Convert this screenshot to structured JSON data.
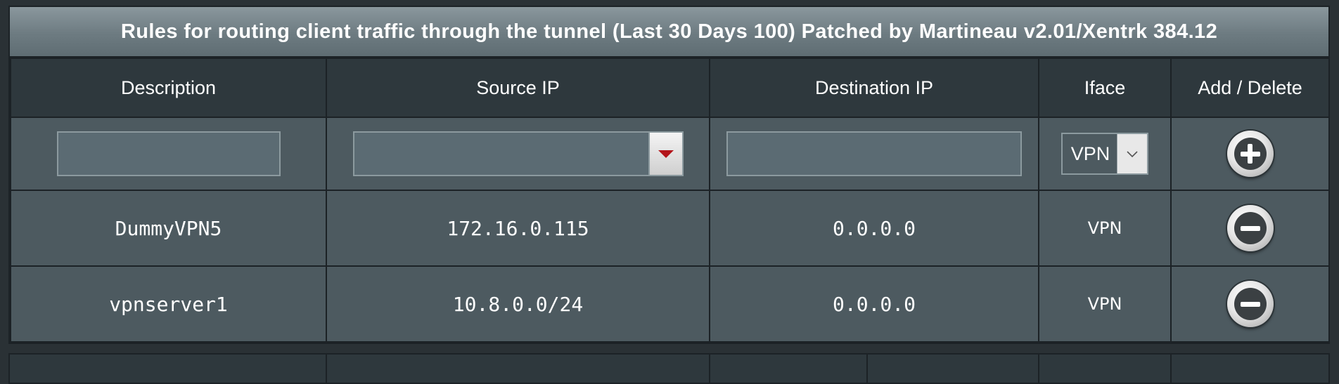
{
  "title": "Rules for routing client traffic through the tunnel (Last 30 Days 100) Patched by Martineau v2.01/Xentrk 384.12",
  "columns": {
    "description": "Description",
    "source_ip": "Source IP",
    "destination_ip": "Destination IP",
    "iface": "Iface",
    "add_delete": "Add / Delete"
  },
  "new_rule": {
    "description_value": "",
    "source_ip_value": "",
    "destination_ip_value": "",
    "iface_selected": "VPN",
    "add_icon": "plus-circle-icon",
    "source_dropdown_icon": "triangle-down-icon"
  },
  "rules": [
    {
      "description": "DummyVPN5",
      "source_ip": "172.16.0.115",
      "destination_ip": "0.0.0.0",
      "iface": "VPN",
      "delete_icon": "minus-circle-icon"
    },
    {
      "description": "vpnserver1",
      "source_ip": "10.8.0.0/24",
      "destination_ip": "0.0.0.0",
      "iface": "VPN",
      "delete_icon": "minus-circle-icon"
    }
  ],
  "colors": {
    "header_bg": "#2e383d",
    "row_bg": "#4d5a60",
    "border": "#1c2226",
    "dropdown_arrow": "#b3141a"
  }
}
